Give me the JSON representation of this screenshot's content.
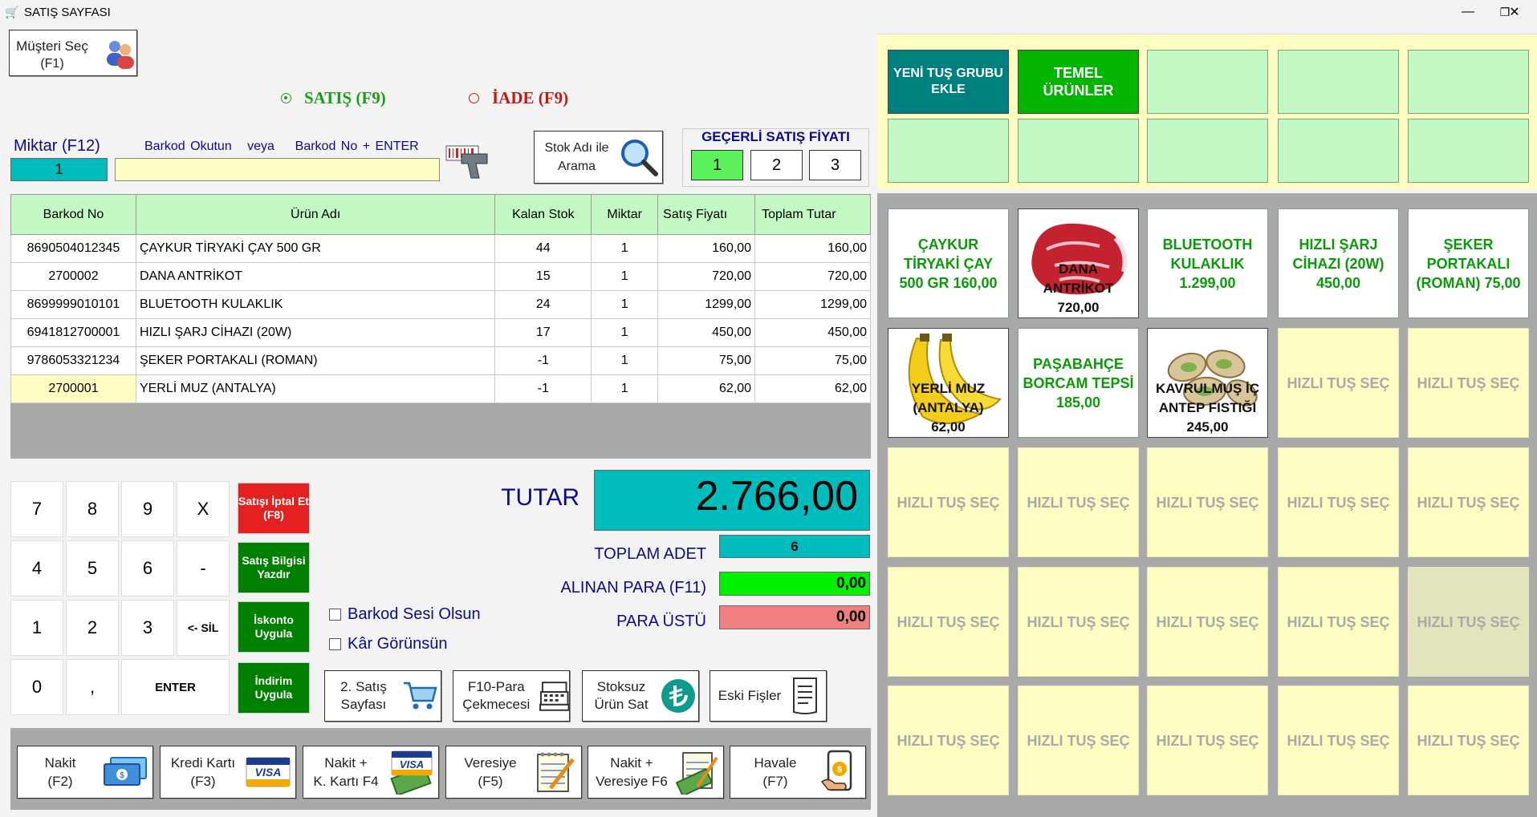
{
  "window": {
    "title": "SATIŞ SAYFASI",
    "minimize": "—",
    "maximize": "❐",
    "close": "✕"
  },
  "customer": {
    "line1": "Müşteri Seç",
    "line2": "(F1)"
  },
  "mode": {
    "sale": "SATIŞ  (F9)",
    "ret": "İADE  (F9)"
  },
  "quantity": {
    "label": "Miktar (F12)",
    "value": "1"
  },
  "barcode": {
    "hint1": "Barkod Okutun",
    "hint2": "veya",
    "hint3": "Barkod No + ENTER",
    "value": ""
  },
  "stock_search": {
    "line1": "Stok Adı ile",
    "line2": "Arama"
  },
  "price_level": {
    "title": "GEÇERLİ SATIŞ FİYATI",
    "options": [
      "1",
      "2",
      "3"
    ],
    "selected": "1"
  },
  "table": {
    "headers": [
      "Barkod No",
      "Ürün Adı",
      "Kalan Stok",
      "Miktar",
      "Satış Fiyatı",
      "Toplam Tutar"
    ],
    "rows": [
      [
        "8690504012345",
        "ÇAYKUR TİRYAKİ ÇAY 500 GR",
        "44",
        "1",
        "160,00",
        "160,00"
      ],
      [
        "2700002",
        "DANA ANTRİKOT",
        "15",
        "1",
        "720,00",
        "720,00"
      ],
      [
        "8699999010101",
        "BLUETOOTH KULAKLIK",
        "24",
        "1",
        "1299,00",
        "1299,00"
      ],
      [
        "6941812700001",
        "HIZLI ŞARJ CİHAZI (20W)",
        "17",
        "1",
        "450,00",
        "450,00"
      ],
      [
        "9786053321234",
        "ŞEKER PORTAKALI (ROMAN)",
        "-1",
        "1",
        "75,00",
        "75,00"
      ],
      [
        "2700001",
        "YERLİ MUZ (ANTALYA)",
        "-1",
        "1",
        "62,00",
        "62,00"
      ]
    ]
  },
  "numpad": [
    "7",
    "8",
    "9",
    "X",
    "4",
    "5",
    "6",
    "-",
    "1",
    "2",
    "3",
    "<- SİL",
    "0",
    ",",
    "ENTER"
  ],
  "green_actions": {
    "cancel": "Satışı İptal Et (F8)",
    "print": "Satış Bilgisi Yazdır",
    "discount": "İskonto Uygula",
    "reduction": "İndirim Uygula"
  },
  "totals": {
    "tutar_label": "TUTAR",
    "tutar": "2.766,00",
    "count_label": "TOPLAM ADET",
    "count": "6",
    "received_label": "ALINAN PARA  (F11)",
    "received": "0,00",
    "change_label": "PARA ÜSTÜ",
    "change": "0,00"
  },
  "checks": {
    "sound": "Barkod Sesi Olsun",
    "profit": "Kâr Görünsün"
  },
  "actions": [
    {
      "l1": "2. Satış",
      "l2": "Sayfası"
    },
    {
      "l1": "F10-Para",
      "l2": "Çekmecesi"
    },
    {
      "l1": "Stoksuz",
      "l2": "Ürün Sat"
    },
    {
      "l1": "Eski Fişler",
      "l2": ""
    }
  ],
  "payments": [
    {
      "l1": "Nakit",
      "l2": "(F2)"
    },
    {
      "l1": "Kredi Kartı",
      "l2": "(F3)"
    },
    {
      "l1": "Nakit +",
      "l2": "K. Kartı F4"
    },
    {
      "l1": "Veresiye",
      "l2": "(F5)"
    },
    {
      "l1": "Nakit +",
      "l2": "Veresiye F6"
    },
    {
      "l1": "Havale",
      "l2": "(F7)"
    }
  ],
  "groups": {
    "new_group": "YENİ TUŞ GRUBU EKLE",
    "basic": "TEMEL ÜRÜNLER"
  },
  "quick_keys": {
    "caykur": {
      "l1": "ÇAYKUR",
      "l2": "TİRYAKİ ÇAY",
      "l3": "500 GR   160,00"
    },
    "dana": {
      "l1": "DANA",
      "l2": "ANTRİKOT",
      "l3": "720,00"
    },
    "bt": {
      "l1": "BLUETOOTH",
      "l2": "KULAKLIK",
      "l3": "1.299,00"
    },
    "sarj": {
      "l1": "HIZLI ŞARJ",
      "l2": "CİHAZI (20W)",
      "l3": "450,00"
    },
    "seker": {
      "l1": "ŞEKER",
      "l2": "PORTAKALI",
      "l3": "(ROMAN)   75,00"
    },
    "muz": {
      "l1": "YERLİ MUZ",
      "l2": "(ANTALYA)",
      "l3": "62,00"
    },
    "pasabahce": {
      "l1": "PAŞABAHÇE",
      "l2": "BORCAM TEPSİ",
      "l3": "185,00"
    },
    "kavrulmus": {
      "l1": "KAVRULMUŞ İÇ",
      "l2": "ANTEP FISTIĞI",
      "l3": "245,00"
    },
    "empty": "HIZLI TUŞ SEÇ"
  },
  "colors": {
    "accent_teal": "#00bcbc",
    "group_teal": "#007f7f",
    "group_green": "#00b400",
    "action_green": "#008000",
    "cancel_red": "#e52020",
    "received_green": "#00f000",
    "change_red": "#f08080",
    "header_green": "#c3f7c3",
    "empty_key": "#fefec3"
  }
}
